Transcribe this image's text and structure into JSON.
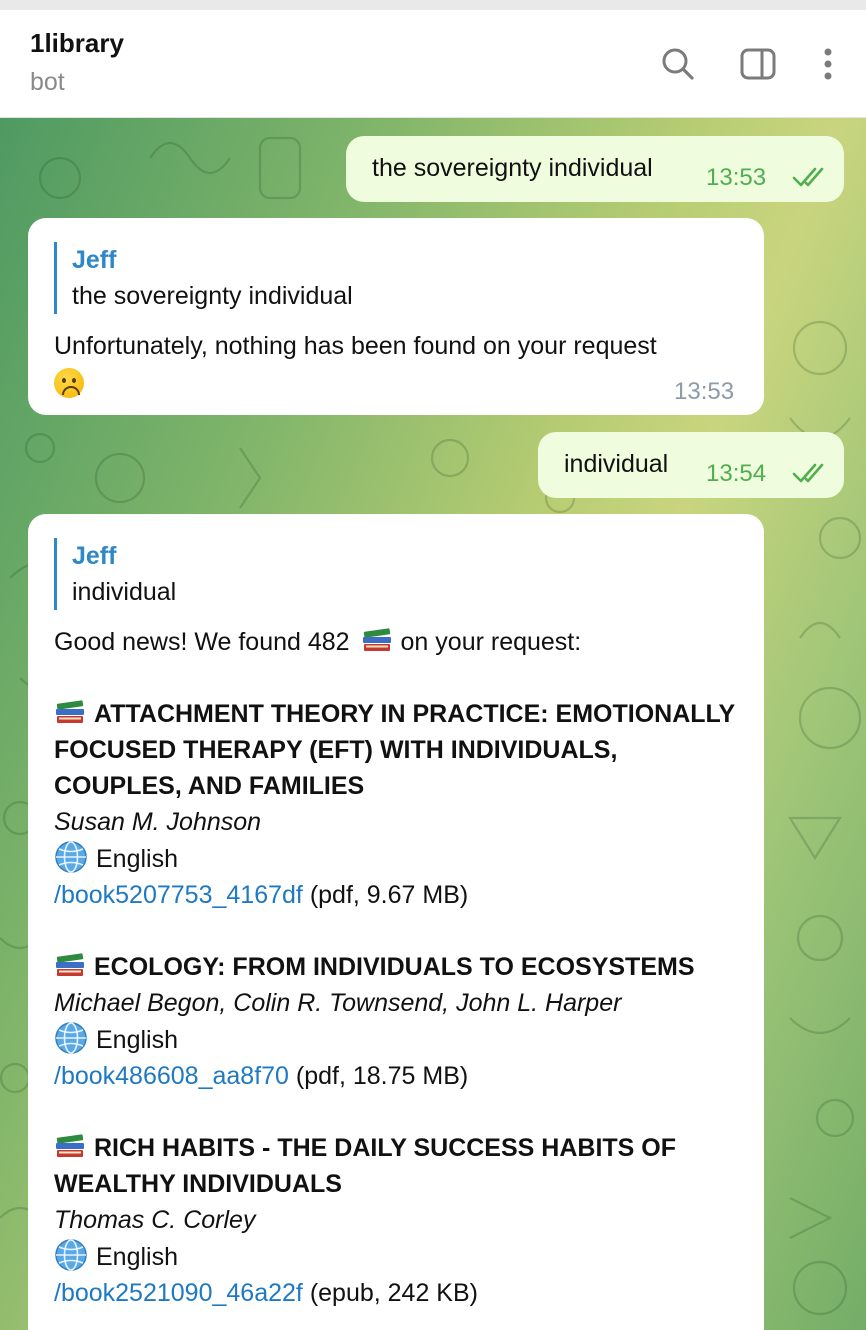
{
  "header": {
    "title": "1library",
    "subtitle": "bot"
  },
  "messages": [
    {
      "text": "the sovereignty individual",
      "time": "13:53"
    },
    {
      "quote_name": "Jeff",
      "quote_text": "the sovereignty individual",
      "text": "Unfortunately, nothing has been found on your request",
      "time": "13:53"
    },
    {
      "text": "individual",
      "time": "13:54"
    },
    {
      "quote_name": "Jeff",
      "quote_text": "individual",
      "intro_before": "Good news! We found 482",
      "intro_after": "on your request:",
      "books": [
        {
          "title": "ATTACHMENT THEORY IN PRACTICE: EMOTIONALLY FOCUSED THERAPY (EFT) WITH INDIVIDUALS, COUPLES, AND FAMILIES",
          "author": "Susan M. Johnson",
          "language": "English",
          "link": "/book5207753_4167df",
          "meta": "(pdf, 9.67 MB)"
        },
        {
          "title": "ECOLOGY: FROM INDIVIDUALS TO ECOSYSTEMS",
          "author": "Michael Begon, Colin R. Townsend, John L. Harper",
          "language": "English",
          "link": "/book486608_aa8f70",
          "meta": "(pdf, 18.75 MB)"
        },
        {
          "title": "RICH HABITS - THE DAILY SUCCESS HABITS OF WEALTHY INDIVIDUALS",
          "author": "Thomas C. Corley",
          "language": "English",
          "link": "/book2521090_46a22f",
          "meta": "(epub, 242 KB)"
        }
      ]
    }
  ],
  "colors": {
    "outgoing_bubble": "#effdde",
    "incoming_bubble": "#ffffff",
    "accent_blue": "#2e87c8",
    "time_green": "#4fae4e"
  },
  "icons": [
    "search-icon",
    "sidebar-toggle-icon",
    "more-vertical-icon",
    "double-check-icon",
    "books-emoji-icon",
    "globe-emoji-icon",
    "sad-face-emoji-icon"
  ]
}
